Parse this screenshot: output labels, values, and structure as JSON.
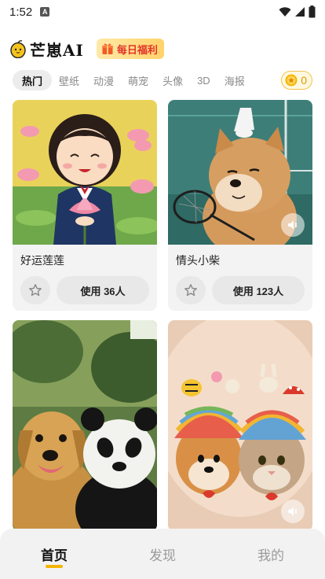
{
  "status_bar": {
    "time": "1:52",
    "notification": "A"
  },
  "header": {
    "app_title": "芒崽AI",
    "daily_badge": "每日福利"
  },
  "tabs": [
    {
      "label": "热门",
      "active": true
    },
    {
      "label": "壁纸",
      "active": false
    },
    {
      "label": "动漫",
      "active": false
    },
    {
      "label": "萌宠",
      "active": false
    },
    {
      "label": "头像",
      "active": false
    },
    {
      "label": "3D",
      "active": false
    },
    {
      "label": "海报",
      "active": false
    }
  ],
  "coins": "0",
  "cards": [
    {
      "name": "好运莲莲",
      "use_label": "使用 36人"
    },
    {
      "name": "情头小柴",
      "use_label": "使用 123人"
    },
    {
      "name": "",
      "use_label": ""
    },
    {
      "name": "",
      "use_label": ""
    }
  ],
  "bottom_nav": [
    {
      "label": "首页",
      "active": true
    },
    {
      "label": "发现",
      "active": false
    },
    {
      "label": "我的",
      "active": false
    }
  ],
  "colors": {
    "accent": "#f5b400",
    "badge_text": "#e2352b",
    "coin": "#d99a00"
  }
}
